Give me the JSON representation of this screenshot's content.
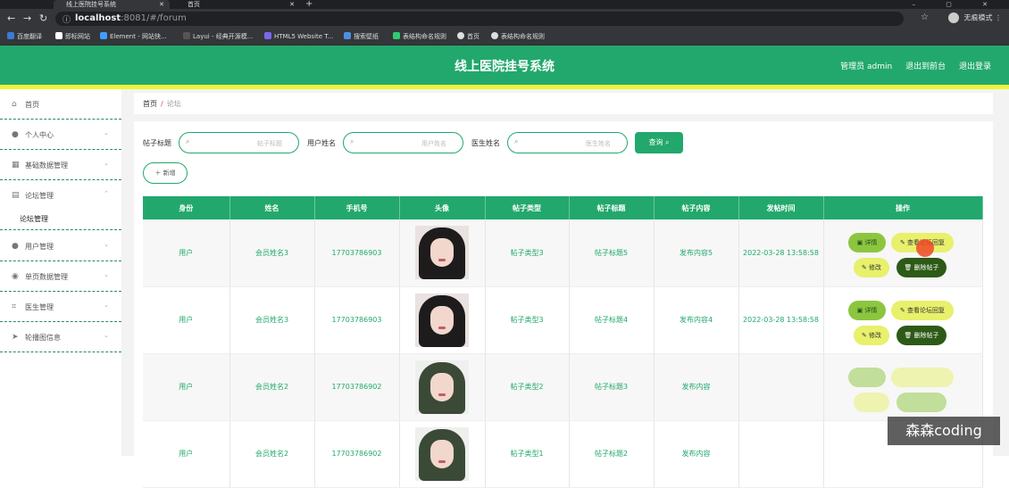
{
  "browser": {
    "active_tab": "线上医院挂号系统",
    "other_tab": "首页",
    "url_host": "localhost",
    "url_rest": ":8081/#/forum",
    "profile": "无痕模式",
    "bookmarks": [
      "百度翻译",
      "即标网站",
      "Element - 网站快...",
      "Layui - 经典开源模...",
      "HTML5 Website T...",
      "搜索壁纸",
      "表结构命名规则",
      "首页",
      "表结构命名规则"
    ]
  },
  "header": {
    "title": "线上医院挂号系统",
    "user": "管理员 admin",
    "back_label": "退出到前台",
    "logout_label": "退出登录"
  },
  "sidebar": {
    "items": [
      {
        "label": "首页"
      },
      {
        "label": "个人中心"
      },
      {
        "label": "基础数据管理"
      },
      {
        "label": "论坛管理"
      },
      {
        "label": "论坛管理"
      },
      {
        "label": "用户管理"
      },
      {
        "label": "单页数据管理"
      },
      {
        "label": "医生管理"
      },
      {
        "label": "轮播图信息"
      }
    ]
  },
  "breadcrumb": {
    "home": "首页",
    "sep": "/",
    "current": "论坛"
  },
  "search": {
    "title_label": "帖子标题",
    "title_ph": "帖子标题",
    "user_label": "用户姓名",
    "user_ph": "用户姓名",
    "doctor_label": "医生姓名",
    "doctor_ph": "医生姓名",
    "query_label": "查询"
  },
  "add_label": "＋ 新增",
  "table": {
    "headers": [
      "身份",
      "姓名",
      "手机号",
      "头像",
      "帖子类型",
      "帖子标题",
      "帖子内容",
      "发帖时间",
      "操作"
    ],
    "rows": [
      {
        "role": "用户",
        "name": "会员姓名3",
        "phone": "17703786903",
        "type": "帖子类型3",
        "title": "帖子标题5",
        "content": "发布内容5",
        "time": "2022-03-28 13:58:58"
      },
      {
        "role": "用户",
        "name": "会员姓名3",
        "phone": "17703786903",
        "type": "帖子类型3",
        "title": "帖子标题4",
        "content": "发布内容4",
        "time": "2022-03-28 13:58:58"
      },
      {
        "role": "用户",
        "name": "会员姓名2",
        "phone": "17703786902",
        "type": "帖子类型2",
        "title": "帖子标题3",
        "content": "发布内容",
        "time": ""
      },
      {
        "role": "用户",
        "name": "会员姓名2",
        "phone": "17703786902",
        "type": "帖子类型1",
        "title": "帖子标题2",
        "content": "发布内容",
        "time": ""
      }
    ],
    "actions": {
      "detail": "详情",
      "reply": "查看论坛回复",
      "edit": "修改",
      "delete": "删除帖子"
    }
  },
  "watermark": "森森coding"
}
